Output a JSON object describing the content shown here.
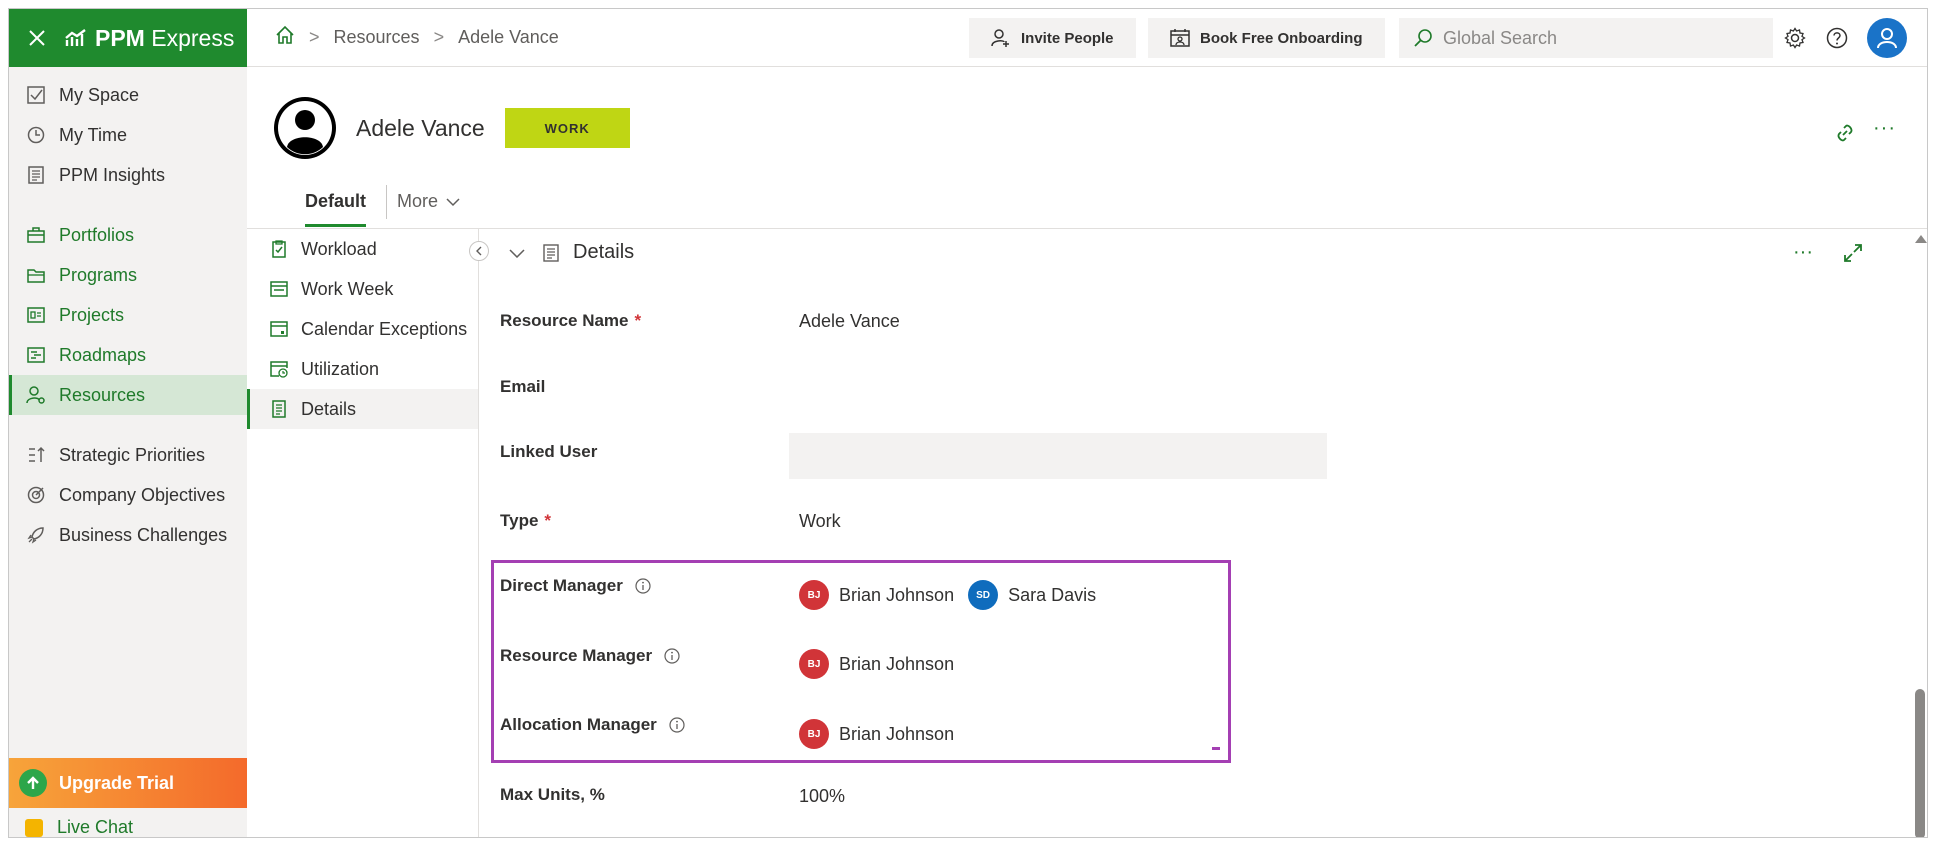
{
  "app": {
    "brand": "PPM",
    "product": "Express"
  },
  "nav": {
    "items_top": [
      {
        "label": "My Space",
        "icon": "checkbox-icon"
      },
      {
        "label": "My Time",
        "icon": "clock-icon"
      },
      {
        "label": "PPM Insights",
        "icon": "report-icon"
      }
    ],
    "items_mid": [
      {
        "label": "Portfolios",
        "icon": "briefcase-icon"
      },
      {
        "label": "Programs",
        "icon": "folders-icon"
      },
      {
        "label": "Projects",
        "icon": "project-icon"
      },
      {
        "label": "Roadmaps",
        "icon": "roadmap-icon"
      },
      {
        "label": "Resources",
        "icon": "person-gear-icon",
        "active": true
      }
    ],
    "items_bottom": [
      {
        "label": "Strategic Priorities",
        "icon": "priority-icon"
      },
      {
        "label": "Company Objectives",
        "icon": "target-icon"
      },
      {
        "label": "Business Challenges",
        "icon": "rocket-icon"
      }
    ],
    "upgrade": "Upgrade Trial",
    "live_chat": "Live Chat"
  },
  "topbar": {
    "breadcrumb": [
      "Resources",
      "Adele Vance"
    ],
    "invite": "Invite People",
    "onboarding": "Book Free Onboarding",
    "search_placeholder": "Global Search"
  },
  "header": {
    "name": "Adele Vance",
    "badge": "WORK",
    "tabs": {
      "default": "Default",
      "more": "More"
    }
  },
  "subnav": [
    {
      "label": "Workload",
      "icon": "clipboard-check-icon"
    },
    {
      "label": "Work Week",
      "icon": "calendar-week-icon"
    },
    {
      "label": "Calendar Exceptions",
      "icon": "calendar-exception-icon"
    },
    {
      "label": "Utilization",
      "icon": "calendar-clock-icon"
    },
    {
      "label": "Details",
      "icon": "document-icon",
      "active": true
    }
  ],
  "details": {
    "title": "Details",
    "fields": {
      "resource_name": {
        "label": "Resource Name",
        "value": "Adele Vance",
        "required": true
      },
      "email": {
        "label": "Email",
        "value": ""
      },
      "linked_user": {
        "label": "Linked User",
        "value": ""
      },
      "type": {
        "label": "Type",
        "value": "Work",
        "required": true
      },
      "direct_manager": {
        "label": "Direct Manager",
        "people": [
          {
            "initials": "BJ",
            "name": "Brian Johnson",
            "color": "#d13438"
          },
          {
            "initials": "SD",
            "name": "Sara Davis",
            "color": "#0f6cbd"
          }
        ]
      },
      "resource_manager": {
        "label": "Resource Manager",
        "people": [
          {
            "initials": "BJ",
            "name": "Brian Johnson",
            "color": "#d13438"
          }
        ]
      },
      "allocation_manager": {
        "label": "Allocation Manager",
        "people": [
          {
            "initials": "BJ",
            "name": "Brian Johnson",
            "color": "#d13438"
          }
        ]
      },
      "max_units": {
        "label": "Max Units, %",
        "value": "100%"
      }
    }
  },
  "colors": {
    "brand_green": "#1f8a2e",
    "work_badge": "#bfd614",
    "highlight": "#a43fb3",
    "required": "#d13438"
  }
}
